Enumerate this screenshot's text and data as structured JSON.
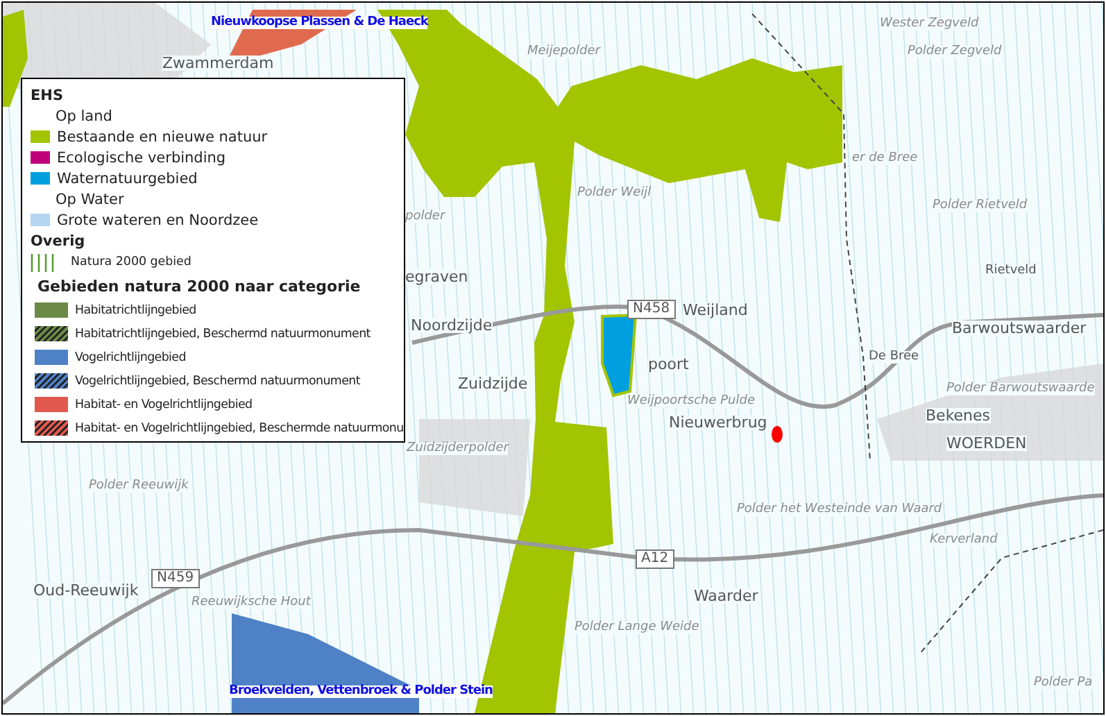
{
  "map": {
    "labels": [
      {
        "text": "Nieuwkoopse Plassen & De Haeck",
        "kind": "natura"
      },
      {
        "text": "Zwammerdam",
        "kind": "place"
      },
      {
        "text": "Meijepolder",
        "kind": "polder"
      },
      {
        "text": "Wester  Zegveld",
        "kind": "polder"
      },
      {
        "text": "Polder Zegveld",
        "kind": "polder"
      },
      {
        "text": "er de Bree",
        "kind": "polder"
      },
      {
        "text": "Polder Weijl",
        "kind": "polder"
      },
      {
        "text": "Polder Rietveld",
        "kind": "polder"
      },
      {
        "text": "polder",
        "kind": "polder"
      },
      {
        "text": "egraven",
        "kind": "place"
      },
      {
        "text": "Rietveld",
        "kind": "small"
      },
      {
        "text": "N458",
        "kind": "road"
      },
      {
        "text": "Weijland",
        "kind": "place"
      },
      {
        "text": "Noordzijde",
        "kind": "place"
      },
      {
        "text": "Barwoutswaarder",
        "kind": "place"
      },
      {
        "text": "De Bree",
        "kind": "small"
      },
      {
        "text": "poort",
        "kind": "place"
      },
      {
        "text": "Zuidzijde",
        "kind": "place"
      },
      {
        "text": "Polder Barwoutswaarde",
        "kind": "polder"
      },
      {
        "text": "Weijpoortsche Pulde",
        "kind": "polder"
      },
      {
        "text": "Nieuwerbrug",
        "kind": "place"
      },
      {
        "text": "Bekenes",
        "kind": "place"
      },
      {
        "text": "WOERDEN",
        "kind": "place"
      },
      {
        "text": "Zuidzijderpolder",
        "kind": "polder"
      },
      {
        "text": "Polder Reeuwijk",
        "kind": "polder"
      },
      {
        "text": "Polder het Westeinde van Waard",
        "kind": "polder"
      },
      {
        "text": "Kerverland",
        "kind": "polder"
      },
      {
        "text": "A12",
        "kind": "road"
      },
      {
        "text": "N459",
        "kind": "road"
      },
      {
        "text": "Oud-Reeuwijk",
        "kind": "place"
      },
      {
        "text": "Reeuwijksche Hout",
        "kind": "polder"
      },
      {
        "text": "Waarder",
        "kind": "place"
      },
      {
        "text": "Polder Lange Weide",
        "kind": "polder"
      },
      {
        "text": "Polder Pa",
        "kind": "polder"
      },
      {
        "text": "Broekvelden, Vettenbroek & Polder Stein",
        "kind": "natura"
      }
    ]
  },
  "legend": {
    "items": [
      {
        "kind": "heading",
        "text": "EHS"
      },
      {
        "kind": "subheading",
        "text": "Op land"
      },
      {
        "kind": "swatch",
        "text": "Bestaande en nieuwe natuur",
        "color": "#a3c400"
      },
      {
        "kind": "swatch",
        "text": "Ecologische verbinding",
        "color": "#c0007a"
      },
      {
        "kind": "swatch",
        "text": "Waternatuurgebied",
        "color": "#00a0e0"
      },
      {
        "kind": "subheading",
        "text": "Op Water"
      },
      {
        "kind": "swatch",
        "text": "Grote wateren en Noordzee",
        "color": "#b4d4ef"
      },
      {
        "kind": "heading",
        "text": "Overig"
      },
      {
        "kind": "lines",
        "text": "Natura 2000 gebied"
      },
      {
        "kind": "title",
        "text": "Gebieden natura 2000 naar categorie"
      },
      {
        "kind": "category",
        "text": "Habitatrichtlijngebied",
        "color": "#6b8a47",
        "hatched": false
      },
      {
        "kind": "category",
        "text": "Habitatrichtlijngebied, Beschermd natuurmonument",
        "color": "#6b8a47",
        "hatched": true
      },
      {
        "kind": "category",
        "text": "Vogelrichtlijngebied",
        "color": "#4f81c7",
        "hatched": false
      },
      {
        "kind": "category",
        "text": "Vogelrichtlijngebied, Beschermd natuurmonument",
        "color": "#4f81c7",
        "hatched": true
      },
      {
        "kind": "category",
        "text": "Habitat- en Vogelrichtlijngebied",
        "color": "#e0584e",
        "hatched": false
      },
      {
        "kind": "category",
        "text": "Habitat- en Vogelrichtlijngebied, Beschermde natuurmonu",
        "color": "#e0584e",
        "hatched": true
      }
    ]
  }
}
